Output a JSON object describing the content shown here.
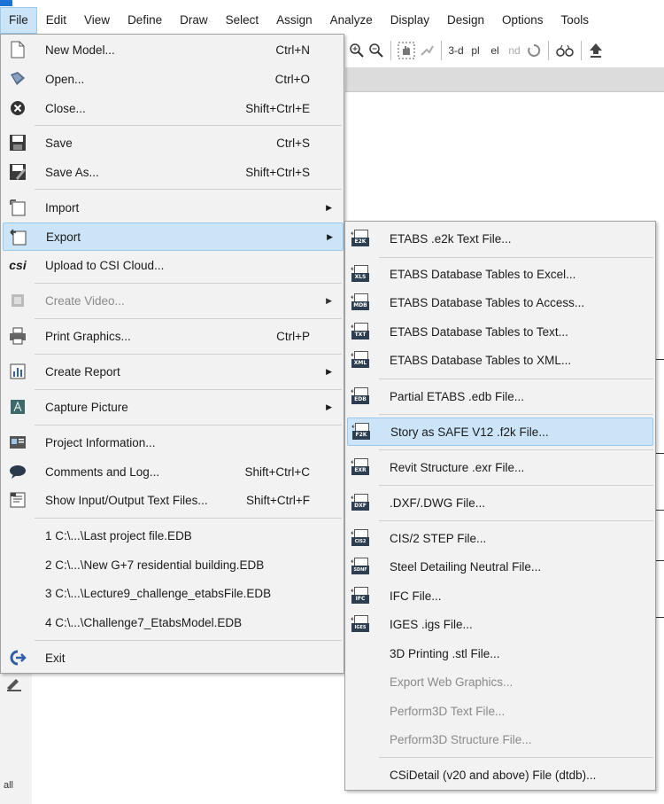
{
  "menubar": {
    "items": [
      "File",
      "Edit",
      "View",
      "Define",
      "Draw",
      "Select",
      "Assign",
      "Analyze",
      "Display",
      "Design",
      "Options",
      "Tools"
    ]
  },
  "toolbar": {
    "labels": [
      "3-d",
      "pl",
      "el",
      "nd"
    ]
  },
  "file_menu": {
    "items": [
      {
        "label": "New Model...",
        "shortcut": "Ctrl+N",
        "icon": "new-file-icon"
      },
      {
        "label": "Open...",
        "shortcut": "Ctrl+O",
        "icon": "open-icon"
      },
      {
        "label": "Close...",
        "shortcut": "Shift+Ctrl+E",
        "icon": "close-icon"
      },
      {
        "label": "Save",
        "shortcut": "Ctrl+S",
        "icon": "save-icon"
      },
      {
        "label": "Save As...",
        "shortcut": "Shift+Ctrl+S",
        "icon": "save-as-icon"
      },
      {
        "label": "Import",
        "shortcut": "",
        "icon": "import-icon"
      },
      {
        "label": "Export",
        "shortcut": "",
        "icon": "export-icon"
      },
      {
        "label": "Upload to CSI Cloud...",
        "shortcut": "",
        "icon": "csi-cloud-icon"
      },
      {
        "label": "Create Video...",
        "shortcut": "",
        "icon": "video-icon"
      },
      {
        "label": "Print Graphics...",
        "shortcut": "Ctrl+P",
        "icon": "printer-icon"
      },
      {
        "label": "Create Report",
        "shortcut": "",
        "icon": "report-icon"
      },
      {
        "label": "Capture Picture",
        "shortcut": "",
        "icon": "picture-icon"
      },
      {
        "label": "Project Information...",
        "shortcut": "",
        "icon": "info-card-icon"
      },
      {
        "label": "Comments and Log...",
        "shortcut": "Shift+Ctrl+C",
        "icon": "comment-icon"
      },
      {
        "label": "Show Input/Output Text Files...",
        "shortcut": "Shift+Ctrl+F",
        "icon": "text-files-icon"
      },
      {
        "label": "1 C:\\...\\Last project file.EDB",
        "shortcut": "",
        "icon": ""
      },
      {
        "label": "2 C:\\...\\New G+7 residential building.EDB",
        "shortcut": "",
        "icon": ""
      },
      {
        "label": "3 C:\\...\\Lecture9_challenge_etabsFile.EDB",
        "shortcut": "",
        "icon": ""
      },
      {
        "label": "4 C:\\...\\Challenge7_EtabsModel.EDB",
        "shortcut": "",
        "icon": ""
      },
      {
        "label": "Exit",
        "shortcut": "",
        "icon": "exit-icon"
      }
    ]
  },
  "export_submenu": {
    "items": [
      {
        "label": "ETABS .e2k Text File...",
        "badge": "E2K"
      },
      {
        "label": "ETABS Database Tables to Excel...",
        "badge": "XLS"
      },
      {
        "label": "ETABS Database Tables to Access...",
        "badge": "MDB"
      },
      {
        "label": "ETABS Database Tables to Text...",
        "badge": "TXT"
      },
      {
        "label": "ETABS Database Tables to XML...",
        "badge": "XML"
      },
      {
        "label": "Partial ETABS .edb File...",
        "badge": "EDB"
      },
      {
        "label": "Story as SAFE V12 .f2k File...",
        "badge": "F2K"
      },
      {
        "label": "Revit Structure .exr File...",
        "badge": "EXR"
      },
      {
        "label": ".DXF/.DWG File...",
        "badge": "DXF"
      },
      {
        "label": "CIS/2 STEP File...",
        "badge": "CIS2"
      },
      {
        "label": "Steel Detailing Neutral File...",
        "badge": "SDNF"
      },
      {
        "label": "IFC File...",
        "badge": "IFC"
      },
      {
        "label": "IGES .igs File...",
        "badge": "IGES"
      },
      {
        "label": "3D Printing .stl File...",
        "badge": ""
      },
      {
        "label": "Export Web Graphics...",
        "badge": ""
      },
      {
        "label": "Perform3D Text File...",
        "badge": ""
      },
      {
        "label": "Perform3D Structure File...",
        "badge": ""
      },
      {
        "label": "CSiDetail (v20 and above) File (dtdb)...",
        "badge": ""
      }
    ]
  },
  "status": {
    "all_label": "all"
  }
}
